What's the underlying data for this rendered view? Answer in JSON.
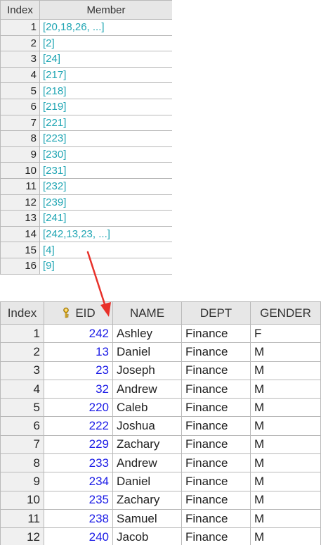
{
  "top_table": {
    "headers": [
      "Index",
      "Member"
    ],
    "rows": [
      {
        "index": "1",
        "member": "[20,18,26, ...]"
      },
      {
        "index": "2",
        "member": "[2]"
      },
      {
        "index": "3",
        "member": "[24]"
      },
      {
        "index": "4",
        "member": "[217]"
      },
      {
        "index": "5",
        "member": "[218]"
      },
      {
        "index": "6",
        "member": "[219]"
      },
      {
        "index": "7",
        "member": "[221]"
      },
      {
        "index": "8",
        "member": "[223]"
      },
      {
        "index": "9",
        "member": "[230]"
      },
      {
        "index": "10",
        "member": "[231]"
      },
      {
        "index": "11",
        "member": "[232]"
      },
      {
        "index": "12",
        "member": "[239]"
      },
      {
        "index": "13",
        "member": "[241]"
      },
      {
        "index": "14",
        "member": "[242,13,23, ...]"
      },
      {
        "index": "15",
        "member": "[4]"
      },
      {
        "index": "16",
        "member": "[9]"
      }
    ]
  },
  "bottom_table": {
    "headers": [
      "Index",
      "EID",
      "NAME",
      "DEPT",
      "GENDER"
    ],
    "key_icon": "key-icon",
    "rows": [
      {
        "index": "1",
        "eid": "242",
        "name": "Ashley",
        "dept": "Finance",
        "gender": "F"
      },
      {
        "index": "2",
        "eid": "13",
        "name": "Daniel",
        "dept": "Finance",
        "gender": "M"
      },
      {
        "index": "3",
        "eid": "23",
        "name": "Joseph",
        "dept": "Finance",
        "gender": "M"
      },
      {
        "index": "4",
        "eid": "32",
        "name": "Andrew",
        "dept": "Finance",
        "gender": "M"
      },
      {
        "index": "5",
        "eid": "220",
        "name": "Caleb",
        "dept": "Finance",
        "gender": "M"
      },
      {
        "index": "6",
        "eid": "222",
        "name": "Joshua",
        "dept": "Finance",
        "gender": "M"
      },
      {
        "index": "7",
        "eid": "229",
        "name": "Zachary",
        "dept": "Finance",
        "gender": "M"
      },
      {
        "index": "8",
        "eid": "233",
        "name": "Andrew",
        "dept": "Finance",
        "gender": "M"
      },
      {
        "index": "9",
        "eid": "234",
        "name": "Daniel",
        "dept": "Finance",
        "gender": "M"
      },
      {
        "index": "10",
        "eid": "235",
        "name": "Zachary",
        "dept": "Finance",
        "gender": "M"
      },
      {
        "index": "11",
        "eid": "238",
        "name": "Samuel",
        "dept": "Finance",
        "gender": "M"
      },
      {
        "index": "12",
        "eid": "240",
        "name": "Jacob",
        "dept": "Finance",
        "gender": "M"
      }
    ]
  },
  "colors": {
    "member_link": "#1fa5b3",
    "eid_value": "#1a1ae6",
    "header_bg": "#e7e7e7",
    "index_bg": "#f0f0f0",
    "grid_line": "#b9b9b9",
    "arrow": "#e8312a"
  }
}
